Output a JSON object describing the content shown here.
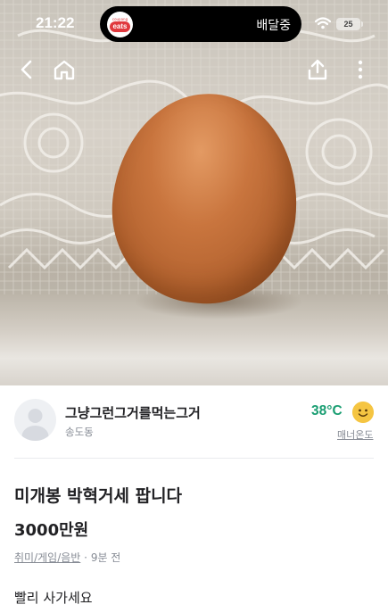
{
  "status_bar": {
    "time": "21:22",
    "app_badge_small": "coupang",
    "app_badge": "eats",
    "delivery_status": "배달중",
    "battery": "25",
    "wifi_icon": "wifi-icon"
  },
  "nav": {
    "back_icon": "chevron-left-icon",
    "home_icon": "home-icon",
    "share_icon": "share-icon",
    "more_icon": "more-vertical-icon"
  },
  "photo": {
    "subject": "egg-photo"
  },
  "seller": {
    "name": "그냥그런그거를먹는그거",
    "location": "송도동",
    "temperature": "38°C",
    "temperature_label": "매너온도",
    "temperature_color": "#1a9e72"
  },
  "post": {
    "title": "미개봉 박혁거세 팝니다",
    "price": "3000만원",
    "category": "취미/게임/음반",
    "separator": "·",
    "time_ago": "9분 전",
    "description": "빨리 사가세요"
  }
}
